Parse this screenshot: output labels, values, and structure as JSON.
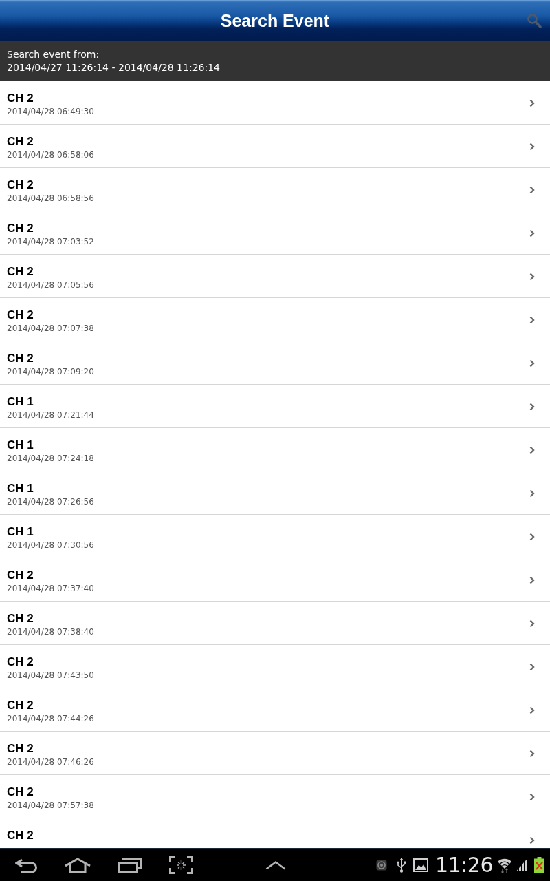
{
  "header": {
    "title": "Search Event"
  },
  "range": {
    "label": "Search event from:",
    "value": "2014/04/27 11:26:14 - 2014/04/28 11:26:14"
  },
  "events": [
    {
      "channel": "CH 2",
      "time": "2014/04/28 06:49:30"
    },
    {
      "channel": "CH 2",
      "time": "2014/04/28 06:58:06"
    },
    {
      "channel": "CH 2",
      "time": "2014/04/28 06:58:56"
    },
    {
      "channel": "CH 2",
      "time": "2014/04/28 07:03:52"
    },
    {
      "channel": "CH 2",
      "time": "2014/04/28 07:05:56"
    },
    {
      "channel": "CH 2",
      "time": "2014/04/28 07:07:38"
    },
    {
      "channel": "CH 2",
      "time": "2014/04/28 07:09:20"
    },
    {
      "channel": "CH 1",
      "time": "2014/04/28 07:21:44"
    },
    {
      "channel": "CH 1",
      "time": "2014/04/28 07:24:18"
    },
    {
      "channel": "CH 1",
      "time": "2014/04/28 07:26:56"
    },
    {
      "channel": "CH 1",
      "time": "2014/04/28 07:30:56"
    },
    {
      "channel": "CH 2",
      "time": "2014/04/28 07:37:40"
    },
    {
      "channel": "CH 2",
      "time": "2014/04/28 07:38:40"
    },
    {
      "channel": "CH 2",
      "time": "2014/04/28 07:43:50"
    },
    {
      "channel": "CH 2",
      "time": "2014/04/28 07:44:26"
    },
    {
      "channel": "CH 2",
      "time": "2014/04/28 07:46:26"
    },
    {
      "channel": "CH 2",
      "time": "2014/04/28 07:57:38"
    },
    {
      "channel": "CH 2"
    }
  ],
  "system_bar": {
    "clock": "11:26"
  }
}
